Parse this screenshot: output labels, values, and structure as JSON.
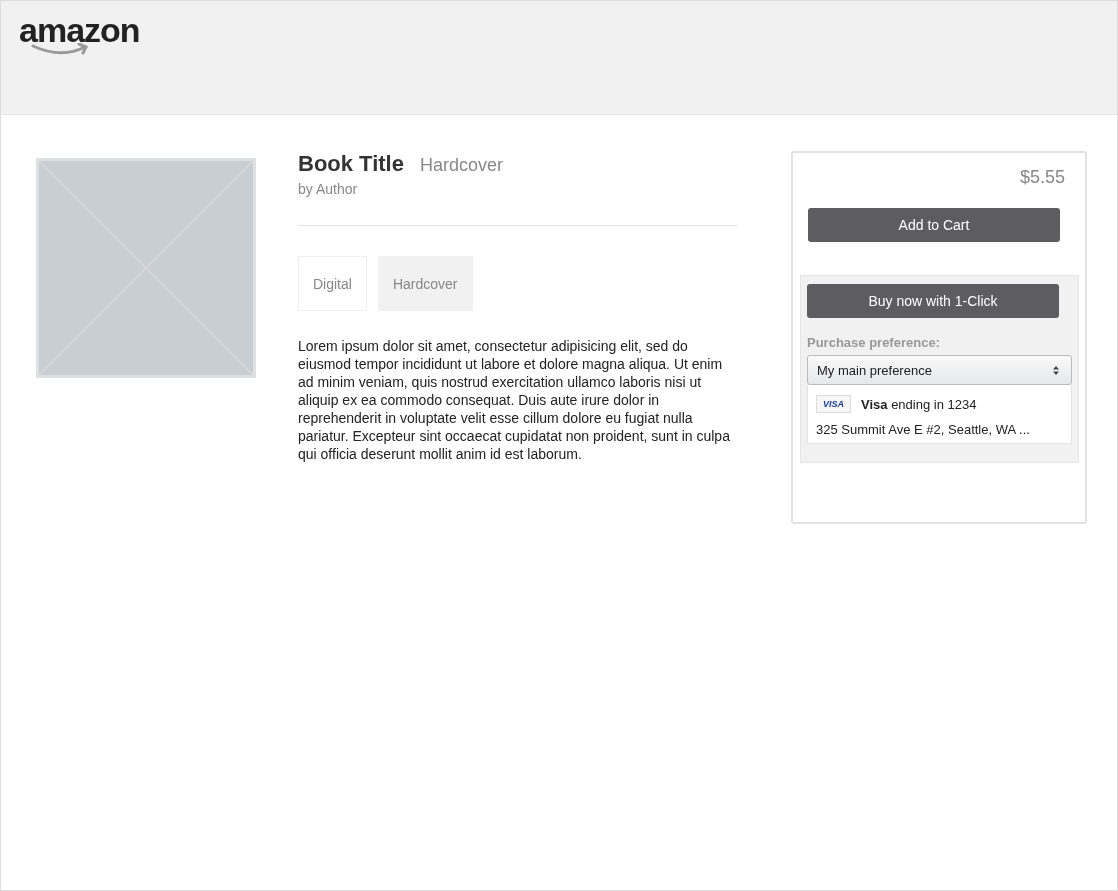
{
  "header": {
    "logo": "amazon"
  },
  "product": {
    "title": "Book Title",
    "format": "Hardcover",
    "author": "by Author",
    "formats": [
      {
        "label": "Digital",
        "selected": false
      },
      {
        "label": "Hardcover",
        "selected": true
      }
    ],
    "description": "Lorem ipsum dolor sit amet, consectetur adipisicing elit, sed do eiusmod tempor incididunt ut labore et dolore magna aliqua. Ut enim ad minim veniam, quis nostrud exercitation ullamco laboris nisi ut aliquip ex ea commodo consequat. Duis aute irure dolor in reprehenderit in voluptate velit esse cillum dolore eu fugiat nulla pariatur. Excepteur sint occaecat cupidatat non proident, sunt in culpa qui officia deserunt mollit anim id est laborum."
  },
  "buy_box": {
    "price": "$5.55",
    "add_to_cart": "Add to Cart",
    "buy_now": "Buy now with 1-Click",
    "preference_label": "Purchase preference:",
    "preference_value": "My main preference",
    "card_logo": "VISA",
    "card": "**Visa** ending in 1234",
    "address": "325 Summit Ave E #2, Seattle, WA ..."
  }
}
